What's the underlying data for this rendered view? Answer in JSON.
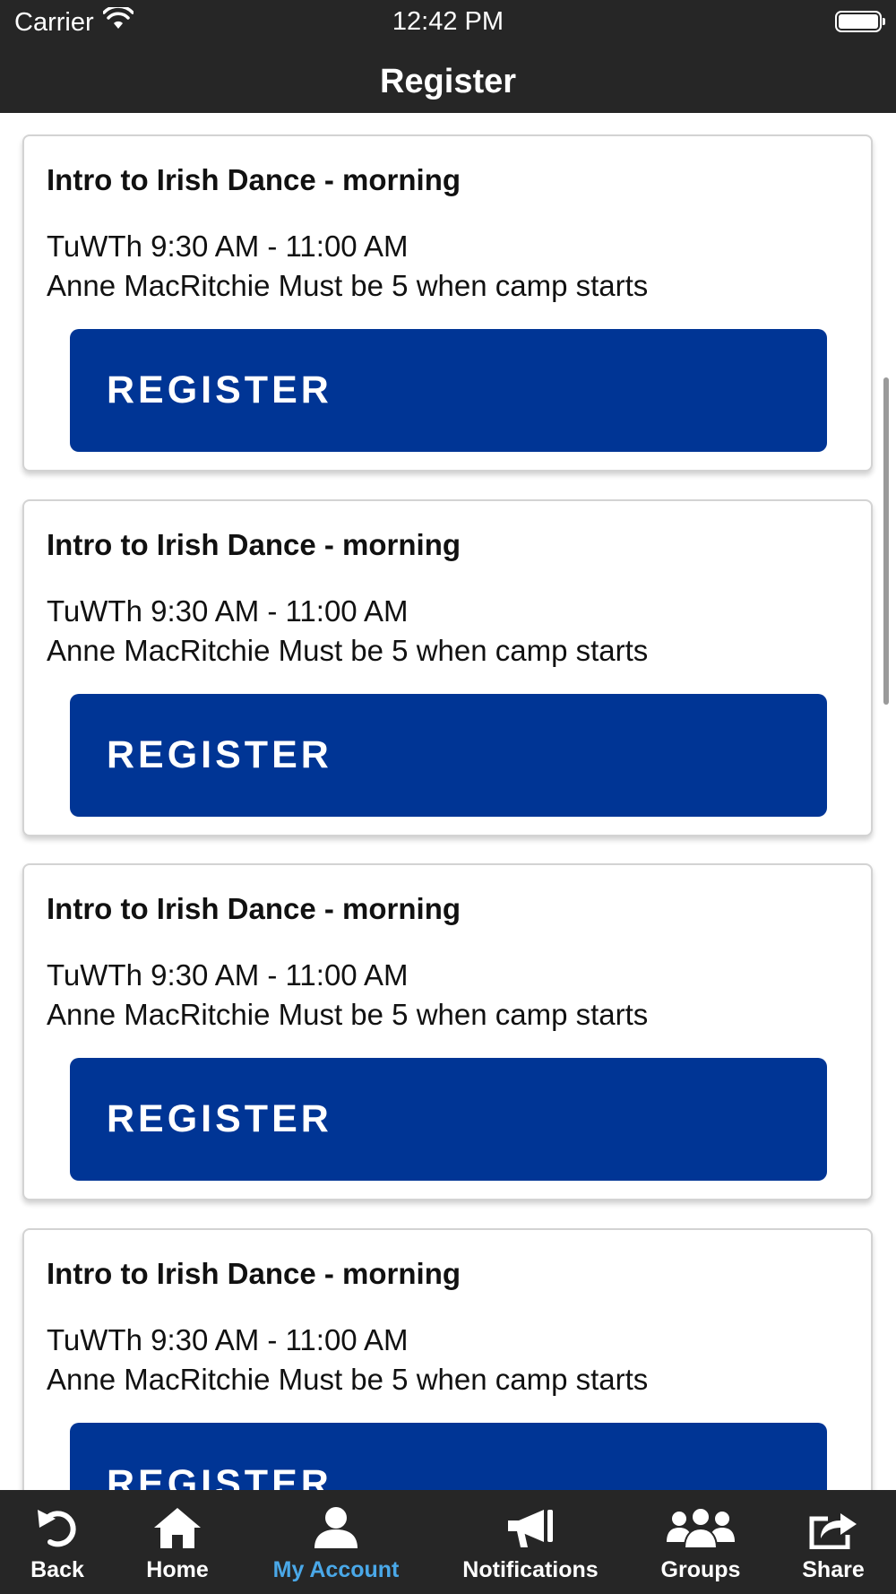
{
  "status_bar": {
    "carrier": "Carrier",
    "time": "12:42 PM"
  },
  "header": {
    "title": "Register"
  },
  "classes": [
    {
      "title": "Intro to Irish Dance - morning",
      "time": "TuWTh 9:30 AM - 11:00 AM",
      "description": "Anne MacRitchie Must be 5 when camp starts",
      "button": "REGISTER"
    },
    {
      "title": "Intro to Irish Dance - morning",
      "time": "TuWTh 9:30 AM - 11:00 AM",
      "description": "Anne MacRitchie Must be 5 when camp starts",
      "button": "REGISTER"
    },
    {
      "title": "Intro to Irish Dance - morning",
      "time": "TuWTh 9:30 AM - 11:00 AM",
      "description": "Anne MacRitchie Must be 5 when camp starts",
      "button": "REGISTER"
    },
    {
      "title": "Intro to Irish Dance - morning",
      "time": "TuWTh 9:30 AM - 11:00 AM",
      "description": "Anne MacRitchie Must be 5 when camp starts",
      "button": "REGISTER"
    }
  ],
  "tabs": [
    {
      "label": "Back",
      "icon": "back-arrow-icon"
    },
    {
      "label": "Home",
      "icon": "home-icon"
    },
    {
      "label": "My Account",
      "icon": "user-icon",
      "active": true
    },
    {
      "label": "Notifications",
      "icon": "megaphone-icon"
    },
    {
      "label": "Groups",
      "icon": "groups-icon"
    },
    {
      "label": "Share",
      "icon": "share-icon"
    }
  ],
  "colors": {
    "bar_bg": "#262626",
    "button_bg": "#003595",
    "active_tab": "#4aa8e8"
  }
}
